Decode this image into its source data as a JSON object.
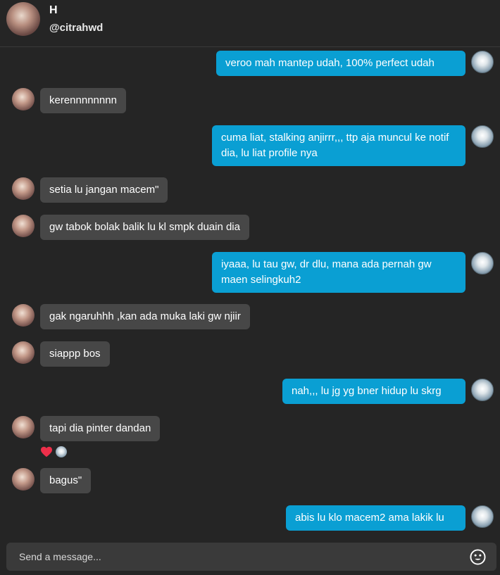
{
  "header": {
    "name": "H",
    "handle": "@citrahwd"
  },
  "messages": [
    {
      "side": "out",
      "text": "veroo mah mantep udah, 100% perfect udah"
    },
    {
      "side": "in",
      "text": "kerennnnnnnn"
    },
    {
      "side": "out",
      "text": "cuma liat, stalking anjirrr,,, ttp aja muncul ke notif dia, lu liat profile nya"
    },
    {
      "side": "in",
      "text": "setia lu jangan macem\""
    },
    {
      "side": "in",
      "text": "gw tabok bolak balik lu kl smpk duain dia"
    },
    {
      "side": "out",
      "text": "iyaaa, lu tau gw, dr dlu, mana ada pernah gw maen selingkuh2"
    },
    {
      "side": "in",
      "text": "gak ngaruhhh ,kan ada muka laki gw njiir"
    },
    {
      "side": "in",
      "text": "siappp bos"
    },
    {
      "side": "out",
      "text": "nah,,, lu jg yg bner hidup lu skrg"
    },
    {
      "side": "in",
      "text": "tapi dia pinter dandan"
    },
    {
      "side": "in",
      "text": "bagus\""
    },
    {
      "side": "out",
      "text": "abis lu klo macem2 ama lakik lu"
    }
  ],
  "composer": {
    "placeholder": "Send a message..."
  },
  "colors": {
    "outgoing_bubble": "#0a9fd3",
    "incoming_bubble": "#474747",
    "background": "#252525",
    "reaction_heart": "#ee2f4a"
  },
  "icons": {
    "reaction": "heart-icon",
    "composer": "emoji-icon"
  }
}
